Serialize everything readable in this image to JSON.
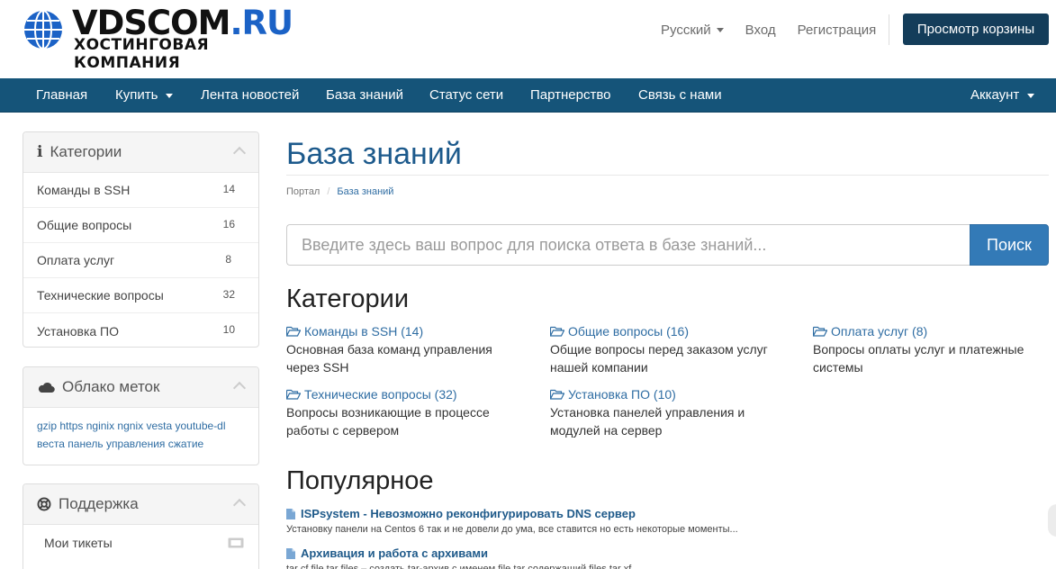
{
  "header": {
    "logo_main": "VDSCOM",
    "logo_tld": ".RU",
    "logo_sub": "ХОСТИНГОВАЯ КОМПАНИЯ",
    "language": "Русский",
    "login": "Вход",
    "register": "Регистрация",
    "cart_button": "Просмотр корзины"
  },
  "nav": {
    "items": [
      "Главная",
      "Купить",
      "Лента новостей",
      "База знаний",
      "Статус сети",
      "Партнерство",
      "Связь с нами"
    ],
    "account": "Аккаунт"
  },
  "sidebar": {
    "categories_title": "Категории",
    "categories": [
      {
        "label": "Команды в SSH",
        "count": "14"
      },
      {
        "label": "Общие вопросы",
        "count": "16"
      },
      {
        "label": "Оплата услуг",
        "count": "8"
      },
      {
        "label": "Технические вопросы",
        "count": "32"
      },
      {
        "label": "Установка ПО",
        "count": "10"
      }
    ],
    "tags_title": "Облако меток",
    "tags": [
      "gzip",
      "https",
      "nginix",
      "ngnix",
      "vesta",
      "youtube-dl",
      "веста",
      "панель управления",
      "сжатие"
    ],
    "support_title": "Поддержка",
    "support_items": [
      "Мои тикеты"
    ]
  },
  "main": {
    "title": "База знаний",
    "breadcrumb": [
      "Портал",
      "База знаний"
    ],
    "search_placeholder": "Введите здесь ваш вопрос для поиска ответа в базе знаний...",
    "search_button": "Поиск",
    "categories_heading": "Категории",
    "categories": [
      {
        "title": "Команды в SSH (14)",
        "desc": "Основная база команд управления через SSH"
      },
      {
        "title": "Общие вопросы (16)",
        "desc": "Общие вопросы перед заказом услуг нашей компании"
      },
      {
        "title": "Оплата услуг (8)",
        "desc": "Вопросы оплаты услуг и платежные системы"
      },
      {
        "title": "Технические вопросы (32)",
        "desc": "Вопросы возникающие в процессе работы с сервером"
      },
      {
        "title": "Установка ПО (10)",
        "desc": "Установка панелей управления и модулей на сервер"
      }
    ],
    "popular_heading": "Популярное",
    "popular": [
      {
        "title": "ISPsystem - Невозможно реконфигурировать DNS сервер",
        "desc": "Установку панели на Centos 6 так и не довели до ума, все ставится но есть некоторые моменты..."
      },
      {
        "title": "Архивация и работа с архивами",
        "desc": "tar cf file.tar files – создать tar-архив с именем file.tar содержащий files tar xf..."
      }
    ]
  },
  "colors": {
    "brand_dark": "#143d5a",
    "nav_bg": "#155479",
    "link": "#2f6da3",
    "title": "#1d5a8c",
    "button": "#337ab7"
  }
}
